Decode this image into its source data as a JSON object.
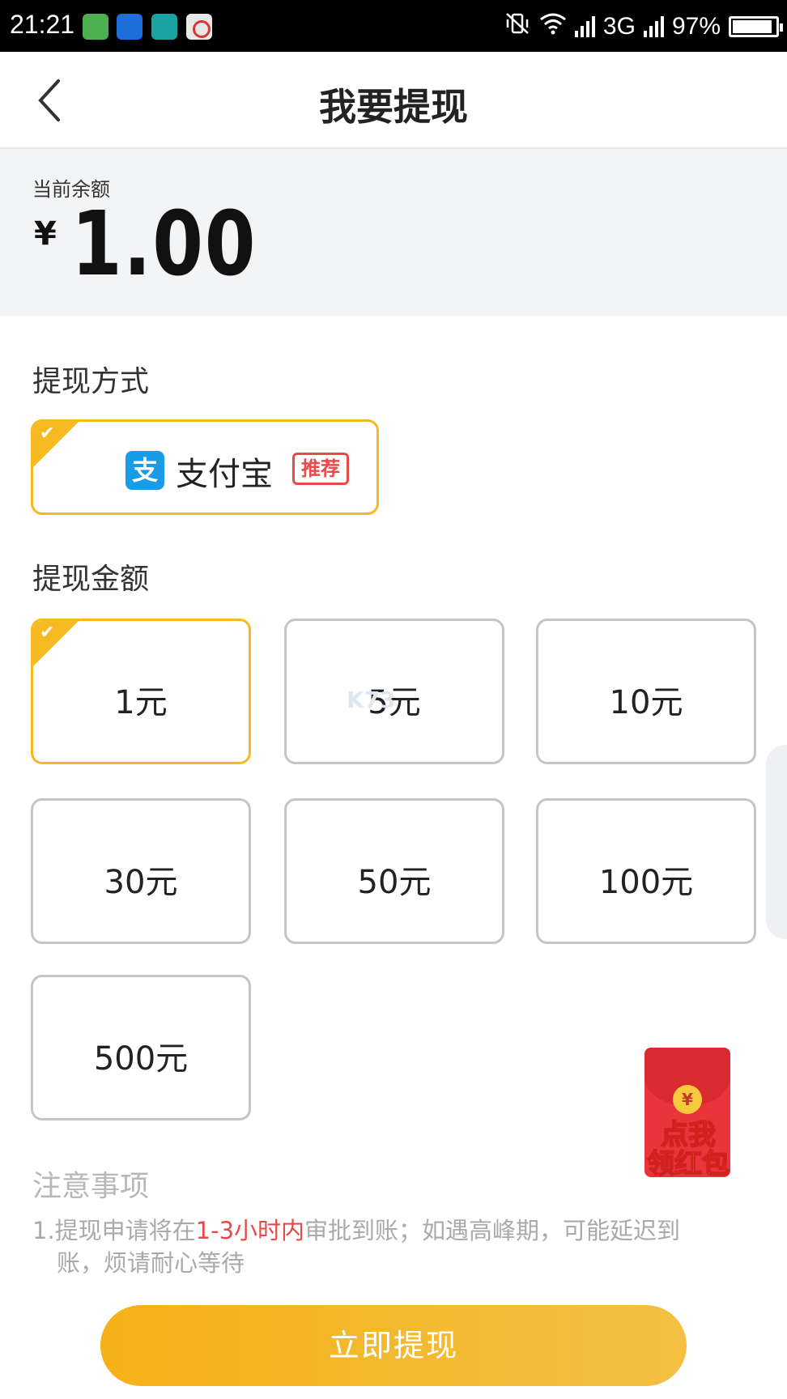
{
  "status_bar": {
    "time": "21:21",
    "network": "3G",
    "battery": "97%",
    "app_icons": [
      "shield-app-icon",
      "message-app-icon",
      "scan-app-icon",
      "weibo-app-icon"
    ]
  },
  "nav": {
    "back_icon": "chevron-left-icon",
    "title": "我要提现"
  },
  "balance": {
    "label": "当前余额",
    "currency": "¥",
    "amount": "1.00"
  },
  "withdraw_method": {
    "title": "提现方式",
    "selected": "支付宝",
    "option": {
      "icon": "alipay-icon",
      "icon_glyph": "支",
      "label": "支付宝",
      "badge": "推荐"
    }
  },
  "withdraw_amount": {
    "title": "提现金额",
    "selected_index": 0,
    "options": [
      "1元",
      "5元",
      "10元",
      "30元",
      "50元",
      "100元",
      "500元"
    ]
  },
  "watermark": "K73",
  "notes": {
    "title": "注意事项",
    "item1_prefix": "1.提现申请将在",
    "item1_highlight": "1-3小时内",
    "item1_suffix": "审批到账；如遇高峰期，可能延迟到",
    "item1_line2": "账，烦请耐心等待"
  },
  "red_packet": {
    "coin": "¥",
    "text_line1": "点我",
    "text_line2": "领红包"
  },
  "bottom": {
    "button_label": "立即提现"
  },
  "colors": {
    "accent": "#f5b922",
    "highlight_red": "#e84a4a",
    "alipay_blue": "#1a9be8"
  }
}
